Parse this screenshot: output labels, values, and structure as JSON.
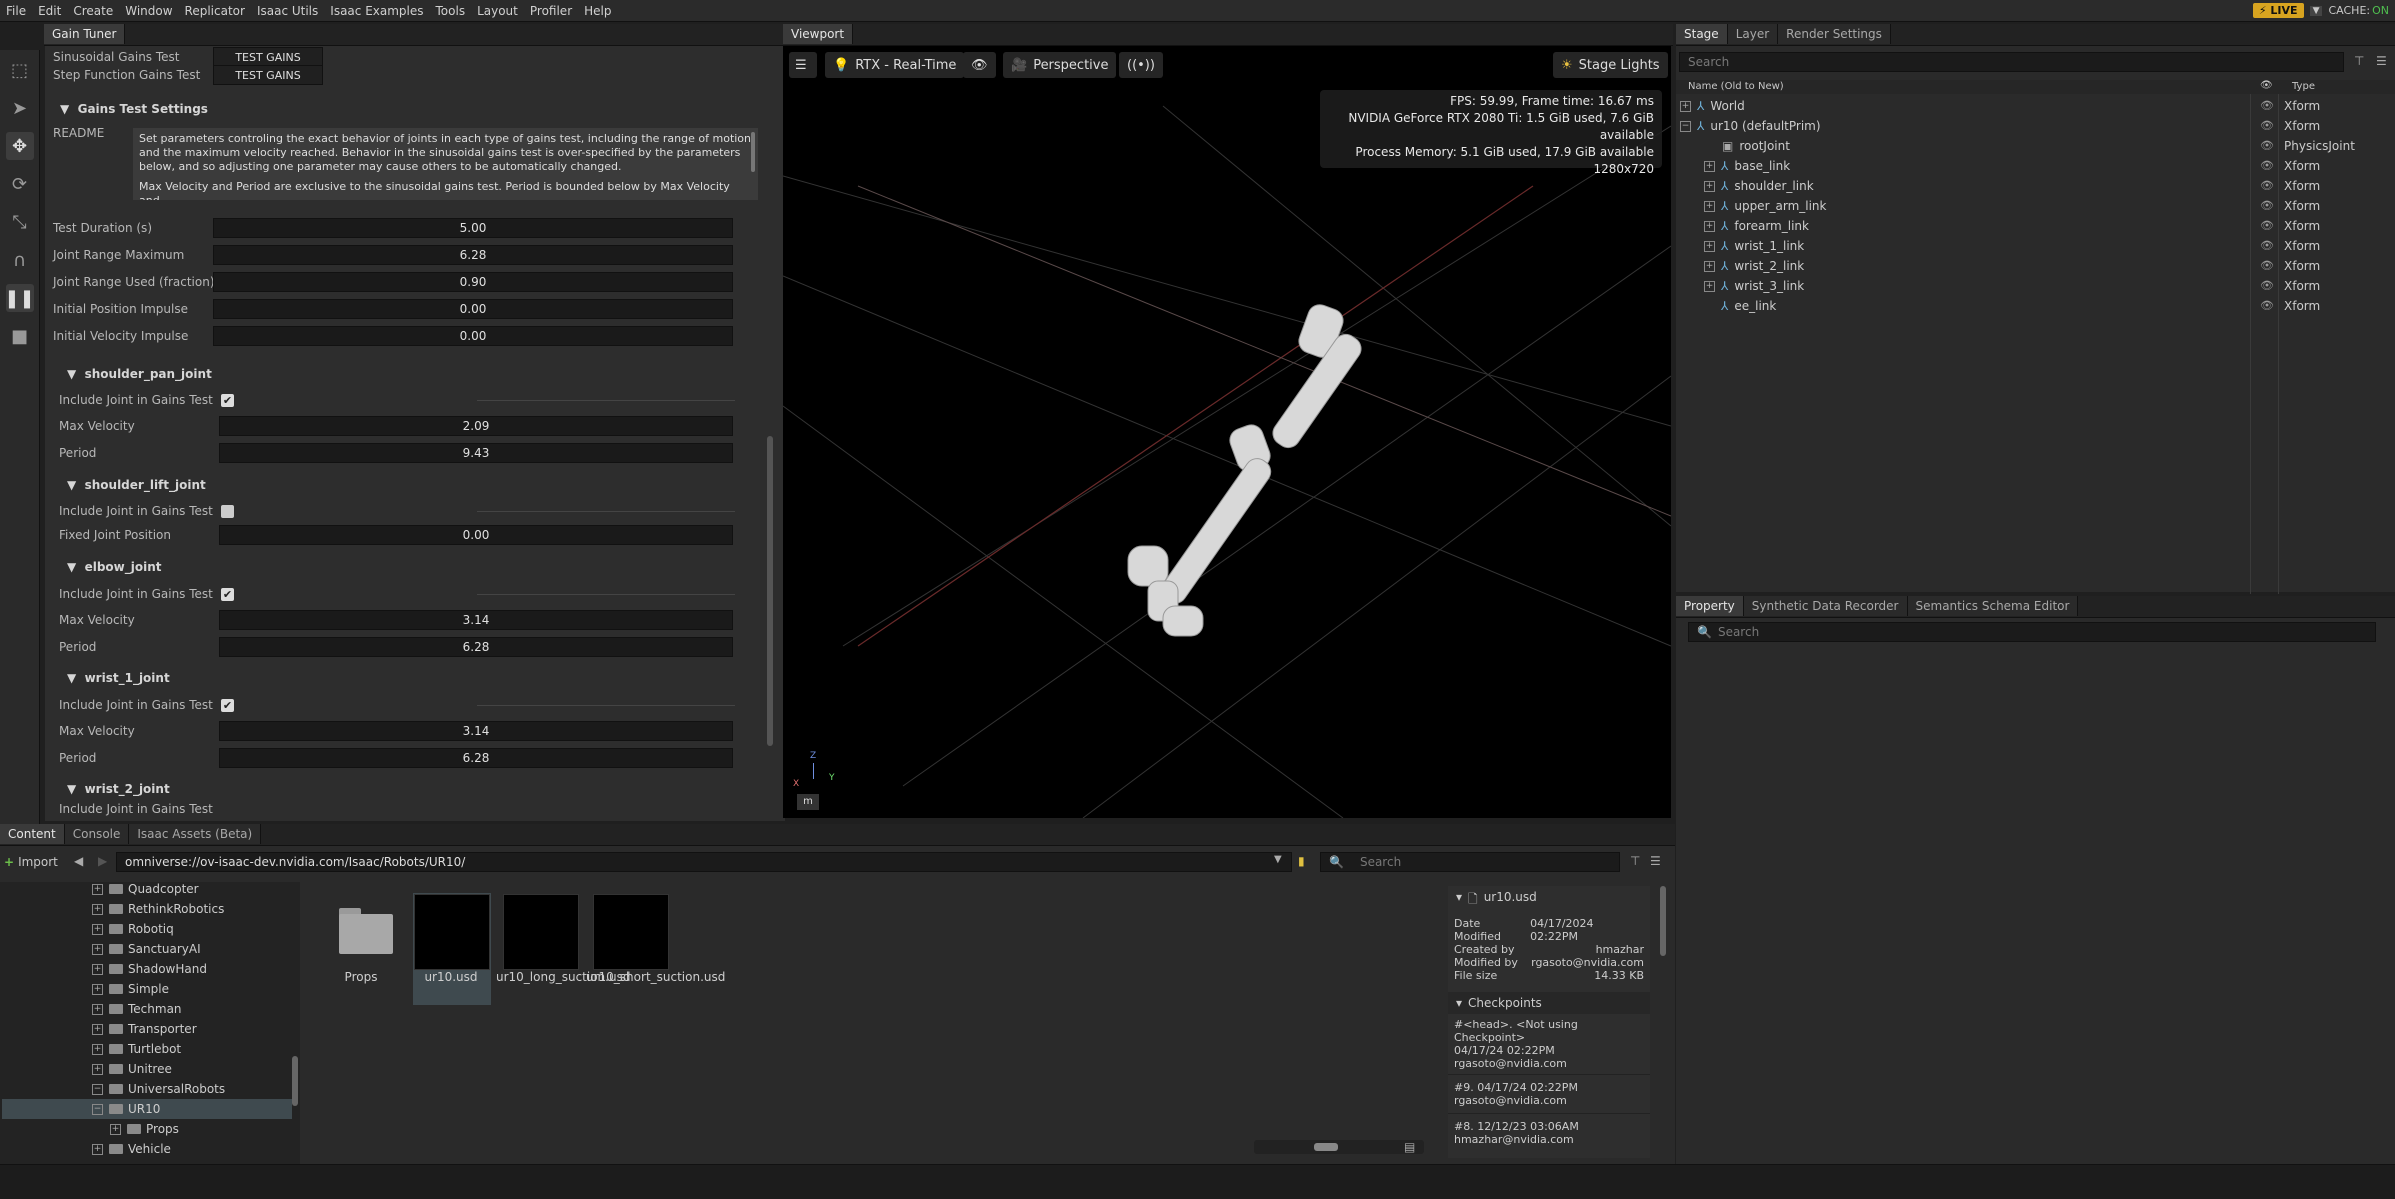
{
  "menu": [
    "File",
    "Edit",
    "Create",
    "Window",
    "Replicator",
    "Isaac Utils",
    "Isaac Examples",
    "Tools",
    "Layout",
    "Profiler",
    "Help"
  ],
  "live": "LIVE",
  "cache_label": "CACHE:",
  "cache_value": "ON",
  "gain": {
    "tab": "Gain Tuner",
    "sinusoidal_label": "Sinusoidal Gains Test",
    "step_label": "Step Function Gains Test",
    "test_gains": "TEST GAINS",
    "settings_header": "Gains Test Settings",
    "readme_label": "README",
    "readme_text": "Set parameters controling the exact behavior of joints in each type of gains test, including the range of motion and the maximum velocity reached.  Behavior in the sinusoidal gains test is over-specified by the parameters below, and so adjusting one parameter may cause others to be automatically changed.",
    "readme_text2": "Max Velocity and Period are exclusive to the sinusoidal gains test. Period is bounded below by Max Velocity and",
    "params": [
      {
        "label": "Test Duration (s)",
        "value": "5.00"
      },
      {
        "label": "Joint Range Maximum",
        "value": "6.28"
      },
      {
        "label": "Joint Range Used (fraction)",
        "value": "0.90"
      },
      {
        "label": "Initial Position Impulse",
        "value": "0.00"
      },
      {
        "label": "Initial Velocity Impulse",
        "value": "0.00"
      }
    ],
    "include": "Include Joint in Gains Test",
    "maxvel": "Max Velocity",
    "period": "Period",
    "fixed": "Fixed Joint Position",
    "joints": [
      {
        "name": "shoulder_pan_joint",
        "v1": "2.09",
        "v2": "9.43"
      },
      {
        "name": "shoulder_lift_joint",
        "v1": "0.00"
      },
      {
        "name": "elbow_joint",
        "v1": "3.14",
        "v2": "6.28"
      },
      {
        "name": "wrist_1_joint",
        "v1": "3.14",
        "v2": "6.28"
      },
      {
        "name": "wrist_2_joint"
      }
    ]
  },
  "viewport": {
    "tab": "Viewport",
    "render": "RTX - Real-Time",
    "camera": "Perspective",
    "lights": "Stage Lights",
    "stats": [
      "FPS: 59.99, Frame time: 16.67 ms",
      "NVIDIA GeForce RTX 2080 Ti: 1.5 GiB used, 7.6 GiB available",
      "Process Memory: 5.1 GiB used, 17.9 GiB available",
      "1280x720"
    ],
    "axis_z": "Z",
    "axis_x": "X",
    "axis_y": "Y",
    "unit": "m"
  },
  "stage": {
    "tabs": [
      "Stage",
      "Layer",
      "Render Settings"
    ],
    "search": "Search",
    "col_name": "Name (Old to New)",
    "col_type": "Type",
    "rows": [
      {
        "name": "World",
        "type": "Xform"
      },
      {
        "name": "ur10 (defaultPrim)",
        "type": "Xform"
      },
      {
        "name": "rootJoint",
        "type": "PhysicsJoint"
      },
      {
        "name": "base_link",
        "type": "Xform"
      },
      {
        "name": "shoulder_link",
        "type": "Xform"
      },
      {
        "name": "upper_arm_link",
        "type": "Xform"
      },
      {
        "name": "forearm_link",
        "type": "Xform"
      },
      {
        "name": "wrist_1_link",
        "type": "Xform"
      },
      {
        "name": "wrist_2_link",
        "type": "Xform"
      },
      {
        "name": "wrist_3_link",
        "type": "Xform"
      },
      {
        "name": "ee_link",
        "type": "Xform"
      }
    ]
  },
  "property": {
    "tabs": [
      "Property",
      "Synthetic Data Recorder",
      "Semantics Schema Editor"
    ],
    "search": "Search"
  },
  "content": {
    "tabs": [
      "Content",
      "Console",
      "Isaac Assets (Beta)"
    ],
    "import": "Import",
    "path": "omniverse://ov-isaac-dev.nvidia.com/Isaac/Robots/UR10/",
    "search": "Search",
    "tree": [
      "Quadcopter",
      "RethinkRobotics",
      "Robotiq",
      "SanctuaryAI",
      "ShadowHand",
      "Simple",
      "Techman",
      "Transporter",
      "Turtlebot",
      "Unitree",
      "UniversalRobots",
      "UR10",
      "Props",
      "Vehicle"
    ],
    "files": [
      "Props",
      "ur10.usd",
      "ur10_long_suction.usd",
      "ur10_short_suction.usd"
    ],
    "info": {
      "file": "ur10.usd",
      "date_label": "Date Modified",
      "date": "04/17/2024 02:22PM",
      "created_label": "Created by",
      "created": "hmazhar",
      "modified_label": "Modified by",
      "modified": "rgasoto@nvidia.com",
      "size_label": "File size",
      "size": "14.33 KB",
      "checkpoints": "Checkpoints",
      "cp": [
        {
          "a": "#<head>.   <Not using Checkpoint>",
          "b": "04/17/24 02:22PM",
          "c": "rgasoto@nvidia.com"
        },
        {
          "a": "#9.   04/17/24 02:22PM",
          "b": "",
          "c": "rgasoto@nvidia.com"
        },
        {
          "a": "#8.   12/12/23 03:06AM",
          "b": "",
          "c": "hmazhar@nvidia.com"
        }
      ]
    }
  }
}
